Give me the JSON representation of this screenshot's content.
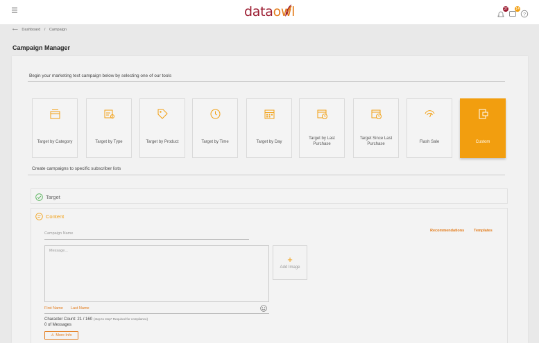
{
  "header": {
    "logo_part1": "data",
    "logo_part2": "owl",
    "bell_badge": "37",
    "messages_badge": "14"
  },
  "breadcrumb": {
    "back_arrow": "⟵",
    "home": "Dashboard",
    "separator": "/",
    "current": "Campaign"
  },
  "page_title": "Campaign Manager",
  "intro_text": "Begin your marketing text campaign below by selecting one of our tools",
  "tools": [
    {
      "label": "Target by Category",
      "icon": "category-icon"
    },
    {
      "label": "Target by Type",
      "icon": "type-icon"
    },
    {
      "label": "Target by Product",
      "icon": "tag-icon"
    },
    {
      "label": "Target by Time",
      "icon": "clock-icon"
    },
    {
      "label": "Target by Day",
      "icon": "calendar-icon"
    },
    {
      "label": "Target by Last Purchase",
      "icon": "calendar-clock-icon"
    },
    {
      "label": "Target Since Last Purchase",
      "icon": "calendar-clock-icon"
    },
    {
      "label": "Flash Sale",
      "icon": "flash-icon"
    },
    {
      "label": "Custom",
      "icon": "custom-icon"
    }
  ],
  "subscriber_text": "Create campaigns to specific subscriber lists",
  "target_panel": {
    "title": "Target"
  },
  "content_panel": {
    "title": "Content",
    "campaign_name_placeholder": "Campaign Name",
    "recommendations": "Recommendations",
    "templates": "Templates",
    "message_placeholder": "Message...",
    "add_image_plus": "+",
    "add_image": "Add Image",
    "first_name": "First Name",
    "last_name": "Last Name",
    "character_count": "Character Count: 21 / 160",
    "character_note": "(stop to stop* Required for compliance)",
    "message_count": "0 of Messages",
    "more_info_icon": "⚠",
    "more_info": "More Info"
  },
  "colors": {
    "accent": "#f29e0f",
    "brand": "#9b1b30",
    "success": "#4caf50"
  }
}
